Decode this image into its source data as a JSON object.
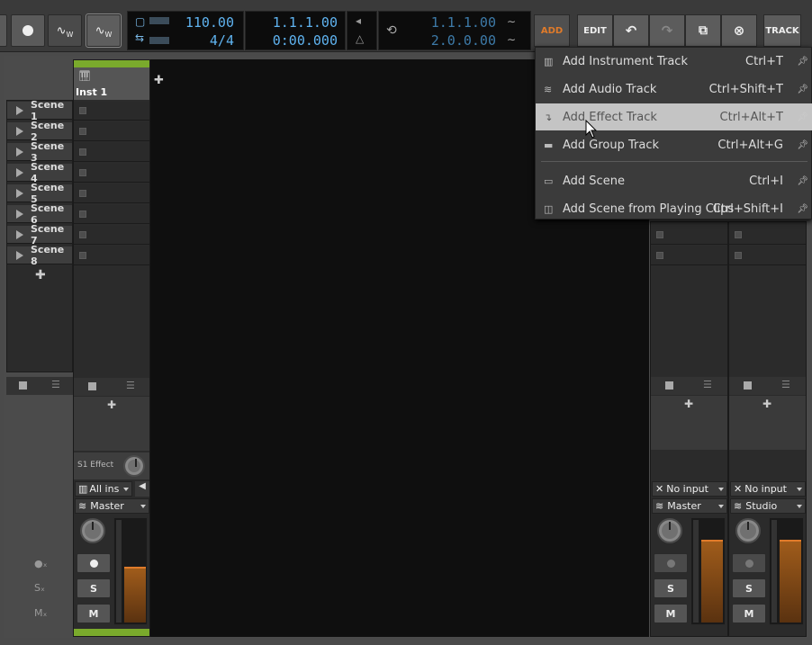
{
  "transport": {
    "tempo": "110.00",
    "time_signature": "4/4",
    "position_bars": "1.1.1.00",
    "position_time": "0:00.000",
    "loop_start": "1.1.1.00",
    "loop_end": "2.0.0.00"
  },
  "toolbar": {
    "add_label": "ADD",
    "edit_label": "EDIT",
    "track_label": "TRACK",
    "write_label_1": "W",
    "write_label_2": "W"
  },
  "menu": {
    "items": [
      {
        "icon": "instrument-track-icon",
        "label": "Add Instrument Track",
        "shortcut": "Ctrl+T"
      },
      {
        "icon": "audio-track-icon",
        "label": "Add Audio Track",
        "shortcut": "Ctrl+Shift+T"
      },
      {
        "icon": "effect-track-icon",
        "label": "Add Effect Track",
        "shortcut": "Ctrl+Alt+T"
      },
      {
        "icon": "group-track-icon",
        "label": "Add Group Track",
        "shortcut": "Ctrl+Alt+G"
      },
      {
        "icon": "scene-icon",
        "label": "Add Scene",
        "shortcut": "Ctrl+I"
      },
      {
        "icon": "scene-from-clips-icon",
        "label": "Add Scene from Playing Clips",
        "shortcut": "Ctrl+Shift+I"
      }
    ]
  },
  "scenes": [
    "Scene 1",
    "Scene 2",
    "Scene 3",
    "Scene 4",
    "Scene 5",
    "Scene 6",
    "Scene 7",
    "Scene 8"
  ],
  "tracks": {
    "inst1": {
      "name": "Inst 1",
      "effect_send": "S1 Effect",
      "input": "All ins",
      "output": "Master",
      "color": "#7aaa2c"
    },
    "fx1": {
      "input": "No input",
      "output": "Master"
    },
    "master": {
      "input": "No input",
      "output": "Studio"
    }
  },
  "mixer_buttons": {
    "solo": "S",
    "mute": "M"
  },
  "left_controls": {
    "solo_x": "S",
    "mute_x": "M"
  }
}
